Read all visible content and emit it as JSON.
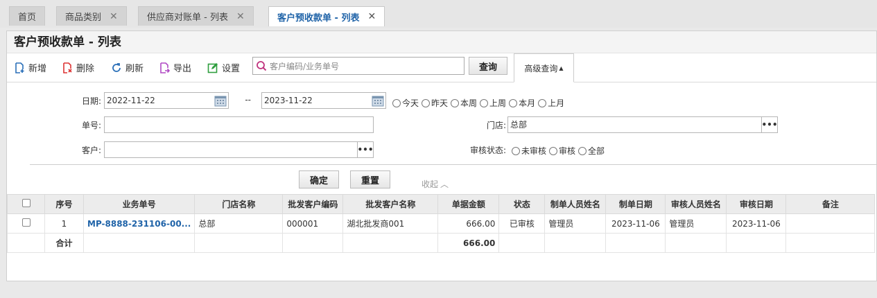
{
  "tabs": [
    {
      "label": "首页",
      "closable": false
    },
    {
      "label": "商品类别",
      "closable": true
    },
    {
      "label": "供应商对账单 - 列表",
      "closable": true
    },
    {
      "label": "客户预收款单 - 列表",
      "closable": true,
      "active": true
    }
  ],
  "close_glyph": "✕",
  "page_title": "客户预收款单 - 列表",
  "toolbar": {
    "add": "新增",
    "delete": "删除",
    "refresh": "刷新",
    "export": "导出",
    "settings": "设置",
    "search_placeholder": "客户编码/业务单号",
    "query": "查询",
    "advanced": "高级查询"
  },
  "filter": {
    "date_label": "日期:",
    "date_from": "2022-11-22",
    "date_sep": "--",
    "date_to": "2023-11-22",
    "quick": [
      "今天",
      "昨天",
      "本周",
      "上周",
      "本月",
      "上月"
    ],
    "no_label": "单号:",
    "store_label": "门店:",
    "store_value": "总部",
    "customer_label": "客户:",
    "audit_label": "审核状态:",
    "audit_options": [
      "未审核",
      "审核",
      "全部"
    ],
    "confirm": "确定",
    "reset": "重置",
    "collapse": "收起"
  },
  "table": {
    "headers": [
      "序号",
      "业务单号",
      "门店名称",
      "批发客户编码",
      "批发客户名称",
      "单据金额",
      "状态",
      "制单人员姓名",
      "制单日期",
      "审核人员姓名",
      "审核日期",
      "备注"
    ],
    "rows": [
      [
        "1",
        "MP-8888-231106-00...",
        "总部",
        "000001",
        "湖北批发商001",
        "666.00",
        "已审核",
        "管理员",
        "2023-11-06",
        "管理员",
        "2023-11-06",
        ""
      ]
    ],
    "total_label": "合计",
    "total_amount": "666.00"
  },
  "colors": {
    "accent": "#1f63a8"
  }
}
